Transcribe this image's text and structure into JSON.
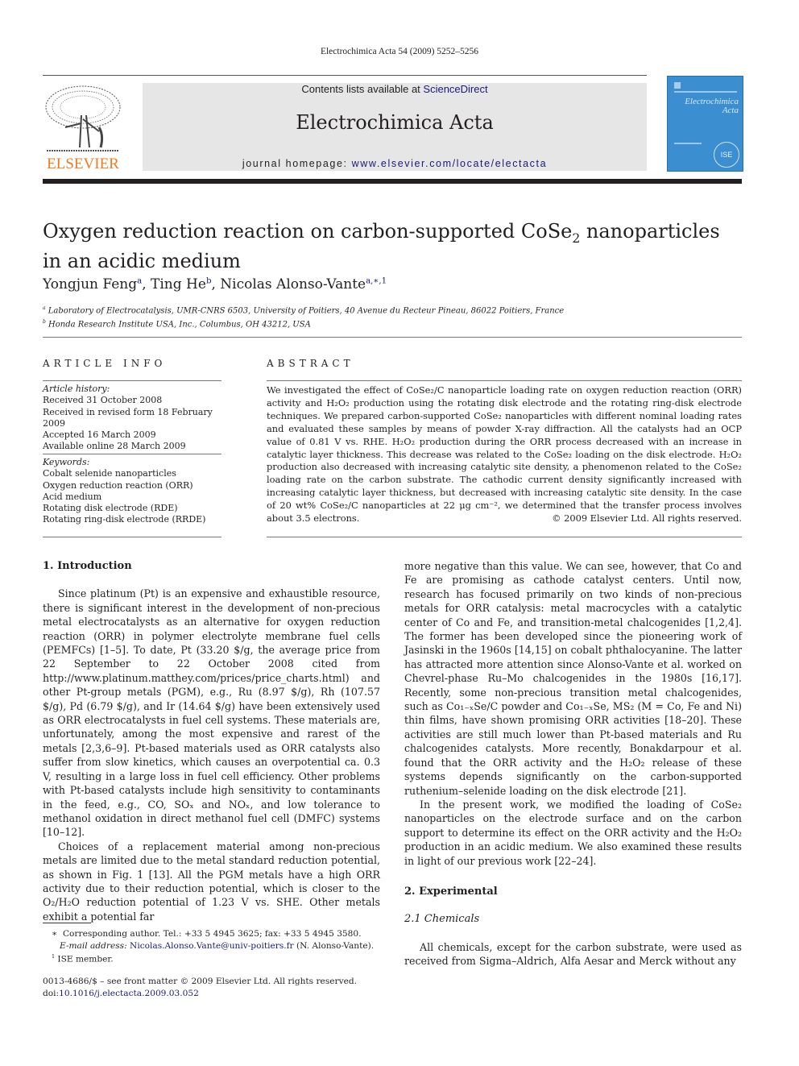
{
  "header": {
    "running_head": "Electrochimica Acta 54 (2009) 5252–5256",
    "publisher_logo_text": "ELSEVIER",
    "contents_prefix": "Contents lists available at ",
    "contents_link": "ScienceDirect",
    "journal_title": "Electrochimica Acta",
    "homepage_prefix": "journal homepage: ",
    "homepage_link": "www.elsevier.com/locate/electacta",
    "cover_title_line1": "Electrochimica",
    "cover_title_line2": "Acta",
    "cover_seal": "ISE",
    "colors": {
      "elsevier_orange": "#f27a1a",
      "link_blue": "#1a1a7a",
      "banner_gray": "#e6e6e6",
      "cover_blue": "#3b8fd0"
    }
  },
  "article": {
    "title_part1": "Oxygen reduction reaction on carbon-supported CoSe",
    "title_sub": "2",
    "title_part2": " nanoparticles",
    "title_line2": "in an acidic medium",
    "authors": [
      {
        "name": "Yongjun Feng",
        "marks": "a"
      },
      {
        "name": "Ting He",
        "marks": "b"
      },
      {
        "name": "Nicolas Alonso-Vante",
        "marks": "a,∗,1"
      }
    ],
    "affiliations": [
      {
        "mark": "a",
        "text": "Laboratory of Electrocatalysis, UMR-CNRS 6503, University of Poitiers, 40 Avenue du Recteur Pineau, 86022 Poitiers, France"
      },
      {
        "mark": "b",
        "text": "Honda Research Institute USA, Inc., Columbus, OH 43212, USA"
      }
    ]
  },
  "article_info": {
    "heading": "ARTICLE INFO",
    "history_label": "Article history:",
    "history": [
      "Received 31 October 2008",
      "Received in revised form 18 February 2009",
      "Accepted 16 March 2009",
      "Available online 28 March 2009"
    ],
    "keywords_label": "Keywords:",
    "keywords": [
      "Cobalt selenide nanoparticles",
      "Oxygen reduction reaction (ORR)",
      "Acid medium",
      "Rotating disk electrode (RDE)",
      "Rotating ring-disk electrode (RRDE)"
    ]
  },
  "abstract": {
    "heading": "ABSTRACT",
    "text": "We investigated the effect of CoSe₂/C nanoparticle loading rate on oxygen reduction reaction (ORR) activity and H₂O₂ production using the rotating disk electrode and the rotating ring-disk electrode techniques. We prepared carbon-supported CoSe₂ nanoparticles with different nominal loading rates and evaluated these samples by means of powder X-ray diffraction. All the catalysts had an OCP value of 0.81 V vs. RHE. H₂O₂ production during the ORR process decreased with an increase in catalytic layer thickness. This decrease was related to the CoSe₂ loading on the disk electrode. H₂O₂ production also decreased with increasing catalytic site density, a phenomenon related to the CoSe₂ loading rate on the carbon substrate. The cathodic current density significantly increased with increasing catalytic layer thickness, but decreased with increasing catalytic site density. In the case of 20 wt% CoSe₂/C nanoparticles at 22 μg cm⁻², we determined that the transfer process involves about 3.5 electrons.",
    "copyright": "© 2009 Elsevier Ltd. All rights reserved."
  },
  "body": {
    "sec1_heading": "1.  Introduction",
    "sec1_p1": "Since platinum (Pt) is an expensive and exhaustible resource, there is significant interest in the development of non-precious metal electrocatalysts as an alternative for oxygen reduction reaction (ORR) in polymer electrolyte membrane fuel cells (PEMFCs) [1–5]. To date, Pt (33.20 $/g, the average price from 22 September to 22 October 2008 cited from http://www.platinum.matthey.com/prices/price_charts.html) and other Pt-group metals (PGM), e.g., Ru (8.97 $/g), Rh (107.57 $/g), Pd (6.79 $/g), and Ir (14.64 $/g) have been extensively used as ORR electrocatalysts in fuel cell systems. These materials are, unfortunately, among the most expensive and rarest of the metals [2,3,6–9]. Pt-based materials used as ORR catalysts also suffer from slow kinetics, which causes an overpotential ca. 0.3 V, resulting in a large loss in fuel cell efficiency. Other problems with Pt-based catalysts include high sensitivity to contaminants in the feed, e.g., CO, SOₓ and NOₓ, and low tolerance to methanol oxidation in direct methanol fuel cell (DMFC) systems [10–12].",
    "sec1_p2": "Choices of a replacement material among non-precious metals are limited due to the metal standard reduction potential, as shown in Fig. 1 [13]. All the PGM metals have a high ORR activity due to their reduction potential, which is closer to the O₂/H₂O reduction potential of 1.23 V vs. SHE. Other metals exhibit a potential far",
    "col2_p1": "more negative than this value. We can see, however, that Co and Fe are promising as cathode catalyst centers. Until now, research has focused primarily on two kinds of non-precious metals for ORR catalysis: metal macrocycles with a catalytic center of Co and Fe, and transition-metal chalcogenides [1,2,4]. The former has been developed since the pioneering work of Jasinski in the 1960s [14,15] on cobalt phthalocyanine. The latter has attracted more attention since Alonso-Vante et al. worked on Chevrel-phase Ru–Mo chalcogenides in the 1980s [16,17]. Recently, some non-precious transition metal chalcogenides, such as Co₁₋ₓSe/C powder and Co₁₋ₓSe, MS₂ (M = Co, Fe and Ni) thin films, have shown promising ORR activities [18–20]. These activities are still much lower than Pt-based materials and Ru chalcogenides catalysts. More recently, Bonakdarpour et al. found that the ORR activity and the H₂O₂ release of these systems depends significantly on the carbon-supported ruthenium–selenide loading on the disk electrode [21].",
    "col2_p2": "In the present work, we modified the loading of CoSe₂ nanoparticles on the electrode surface and on the carbon support to determine its effect on the ORR activity and the H₂O₂ production in an acidic medium. We also examined these results in light of our previous work [22–24].",
    "sec2_heading": "2.  Experimental",
    "sec2_1_heading": "2.1 Chemicals",
    "sec2_1_p1": "All chemicals, except for the carbon substrate, were used as received from Sigma–Aldrich, Alfa Aesar and Merck without any"
  },
  "footnotes": {
    "corresponding": "Corresponding author. Tel.: +33 5 4945 3625; fax: +33 5 4945 3580.",
    "email_label": "E-mail address: ",
    "email": "Nicolas.Alonso.Vante@univ-poitiers.fr",
    "email_suffix": " (N. Alonso-Vante).",
    "ise": "ISE member.",
    "star_mark": "∗",
    "one_mark": "1",
    "front_matter": "0013-4686/$ – see front matter © 2009 Elsevier Ltd. All rights reserved.",
    "doi_label": "doi:",
    "doi": "10.1016/j.electacta.2009.03.052"
  }
}
